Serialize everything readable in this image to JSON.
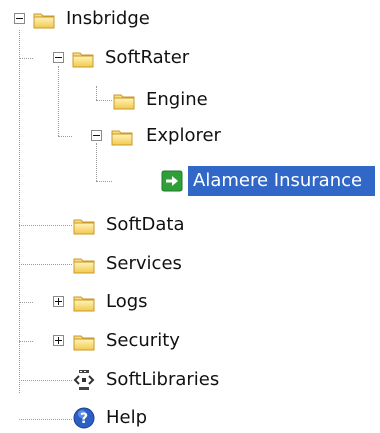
{
  "tree": {
    "root": {
      "label": "Insbridge",
      "icon": "folder-icon",
      "expanded": true,
      "children": {
        "softrater": {
          "label": "SoftRater",
          "icon": "folder-icon",
          "expanded": true,
          "children": {
            "engine": {
              "label": "Engine",
              "icon": "folder-icon"
            },
            "explorer": {
              "label": "Explorer",
              "icon": "folder-icon",
              "expanded": true,
              "children": {
                "alamere": {
                  "label": "Alamere Insurance",
                  "icon": "green-arrow-icon",
                  "selected": true
                }
              }
            }
          }
        },
        "softdata": {
          "label": "SoftData",
          "icon": "folder-icon"
        },
        "services": {
          "label": "Services",
          "icon": "folder-icon"
        },
        "logs": {
          "label": "Logs",
          "icon": "folder-icon",
          "expanded": false
        },
        "security": {
          "label": "Security",
          "icon": "folder-icon",
          "expanded": false
        },
        "softlibraries": {
          "label": "SoftLibraries",
          "icon": "code-brackets-icon"
        },
        "help": {
          "label": "Help",
          "icon": "help-icon"
        }
      }
    }
  },
  "colors": {
    "selection": "#3168c8",
    "selection_text": "#ffffff",
    "folder_body": "#f8d775",
    "folder_outline": "#c89a28",
    "arrow_green": "#2fa037",
    "help_blue": "#2b5fc6",
    "tree_lines": "#9a9a9a"
  }
}
